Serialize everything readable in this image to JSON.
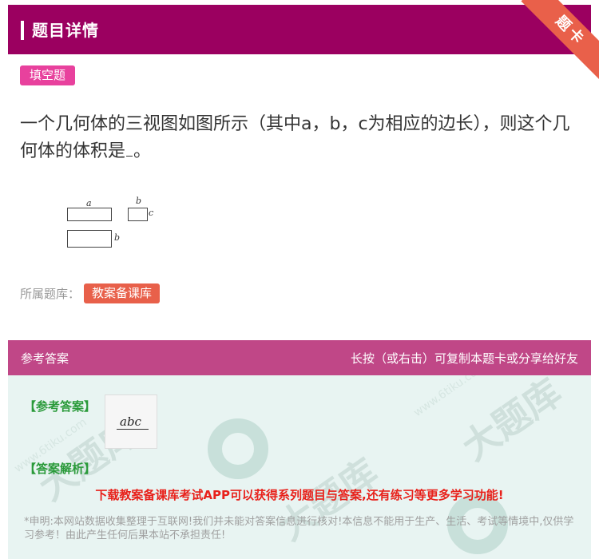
{
  "header": {
    "title": "题目详情"
  },
  "ribbon": {
    "label": "题卡"
  },
  "question": {
    "type_badge": "填空题",
    "text_before_blank": "一个几何体的三视图如图所示（其中a，b，c为相应的边长），则这个几何体的体积是",
    "text_after_blank": "。",
    "diagram_labels": {
      "a": "a",
      "b_top": "b",
      "c": "c",
      "b_bottom": "b"
    }
  },
  "bank": {
    "label": "所属题库：",
    "value": "教案备课库"
  },
  "answer_section": {
    "left_title": "参考答案",
    "right_hint": "长按（或右击）可复制本题卡或分享给好友",
    "answer_label": "【参考答案】",
    "answer_image_text": "abc",
    "explanation_label": "【答案解析】",
    "promo": "下载教案备课库考试APP可以获得系列题目与答案,还有练习等更多学习功能!",
    "disclaimer": "*申明:本网站数据收集整理于互联网!我们并未能对答案信息进行核对!本信息不能用于生产、生活、考试等情境中,仅供学习参考！由此产生任何后果本站不承担责任!",
    "watermark": "大题库",
    "watermark_url": "www.6tiku.com"
  },
  "colors": {
    "header_bg": "#9b0060",
    "answer_header_bg": "#c04787",
    "type_badge_bg": "#e8419d",
    "bank_badge_bg": "#e8604a",
    "promo_text": "#e8211b",
    "label_green": "#2a9a3a"
  }
}
